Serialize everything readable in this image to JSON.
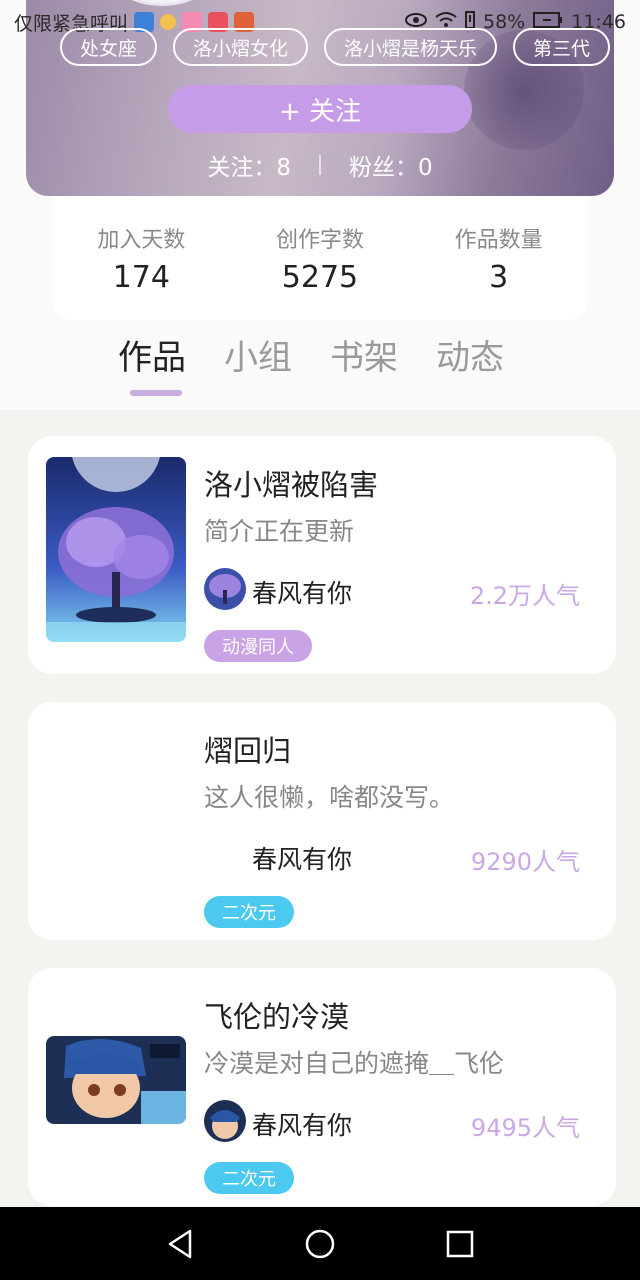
{
  "status_bar": {
    "carrier": "仅限紧急呼叫",
    "battery": "58%",
    "time": "11:46"
  },
  "profile": {
    "tags": [
      "处女座",
      "洛小熠女化",
      "洛小熠是杨天乐",
      "第三代"
    ],
    "follow_button": "+  关注",
    "following_label": "关注：8",
    "fans_label": "粉丝：0"
  },
  "stats": [
    {
      "label": "加入天数",
      "value": "174"
    },
    {
      "label": "创作字数",
      "value": "5275"
    },
    {
      "label": "作品数量",
      "value": "3"
    }
  ],
  "tabs": [
    "作品",
    "小组",
    "书架",
    "动态"
  ],
  "active_tab": "作品",
  "works": [
    {
      "title": "洛小熠被陷害",
      "desc": "简介正在更新",
      "author": "春风有你",
      "popularity": "2.2万人气",
      "badge": "动漫同人",
      "badge_color": "#c9a3e6",
      "cover": "purple-tree-cover"
    },
    {
      "title": "熠回归",
      "desc": "这人很懒，啥都没写。",
      "author": "春风有你",
      "popularity": "9290人气",
      "badge": "二次元",
      "badge_color": "#4cc9f0",
      "cover": "none"
    },
    {
      "title": "飞伦的冷漠",
      "desc": "冷漠是对自己的遮掩＿飞伦",
      "author": "春风有你",
      "popularity": "9495人气",
      "badge": "二次元",
      "badge_color": "#4cc9f0",
      "cover": "anime-boy-cover"
    }
  ],
  "colors": {
    "accent": "#c69be8",
    "popularity": "#caa8e6",
    "tab_underline": "#c8aee0"
  }
}
